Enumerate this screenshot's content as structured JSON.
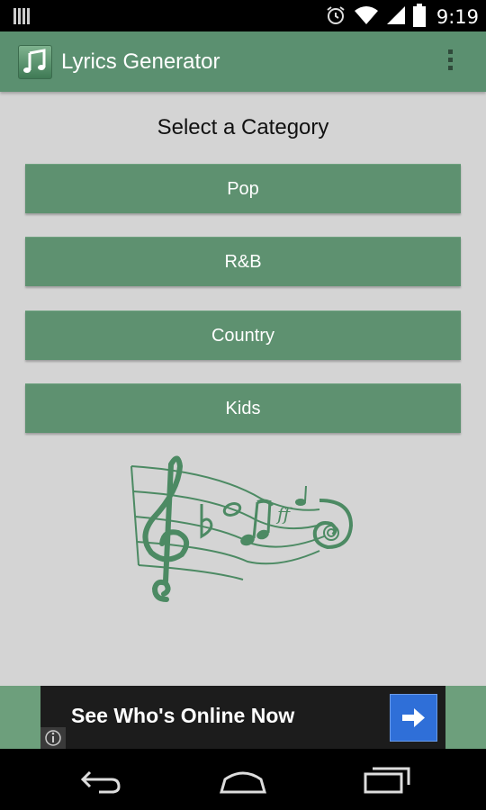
{
  "status_bar": {
    "time": "9:19",
    "icons": [
      "notification-bars-icon",
      "alarm-icon",
      "wifi-icon",
      "signal-icon",
      "battery-icon"
    ]
  },
  "action_bar": {
    "title": "Lyrics Generator",
    "icon": "music-note-icon",
    "menu_icon": "overflow-menu-icon"
  },
  "content": {
    "heading": "Select a Category",
    "categories": [
      {
        "label": "Pop"
      },
      {
        "label": "R&B"
      },
      {
        "label": "Country"
      },
      {
        "label": "Kids"
      }
    ]
  },
  "ad": {
    "text": "See Who's Online Now",
    "arrow_icon": "arrow-right-icon",
    "info_icon": "info-icon"
  },
  "nav_bar": {
    "icons": [
      "back-icon",
      "home-icon",
      "recent-apps-icon"
    ]
  },
  "colors": {
    "accent": "#5b9070",
    "button": "#5e9170",
    "background": "#d4d4d4",
    "ad_button": "#2f6fd8"
  }
}
